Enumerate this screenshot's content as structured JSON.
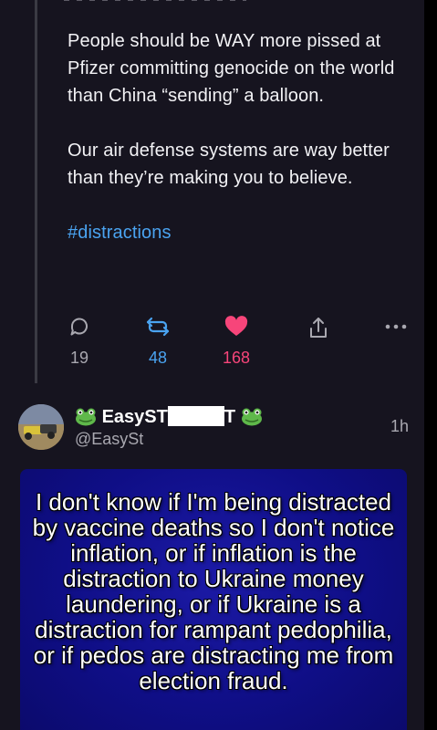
{
  "tweet": {
    "paragraphs": [
      "People should be WAY more pissed at Pfizer committing genocide on the world than China “sending” a balloon.",
      "Our air defense systems are way better than they’re making you to believe."
    ],
    "hashtag": "#distractions",
    "actions": {
      "reply_count": "19",
      "retweet_count": "48",
      "like_count": "168"
    }
  },
  "reply": {
    "name_prefix": "EasyST",
    "name_suffix": "T",
    "handle": "@EasySt",
    "time": "1h",
    "meme_text": "I don't know if I'm being distracted by vaccine deaths so I don't notice inflation, or if inflation is the distraction to Ukraine money laundering, or if Ukraine is a distraction for rampant pedophilia, or if pedos are distracting me from election fraud."
  },
  "colors": {
    "background": "#16141f",
    "accent_blue": "#4aa3f0",
    "like_pink": "#f7457a",
    "meme_blue": "#0f0e86"
  },
  "icons": [
    "reply-icon",
    "retweet-icon",
    "like-heart-icon",
    "share-icon",
    "more-icon",
    "frog-emoji-icon"
  ]
}
